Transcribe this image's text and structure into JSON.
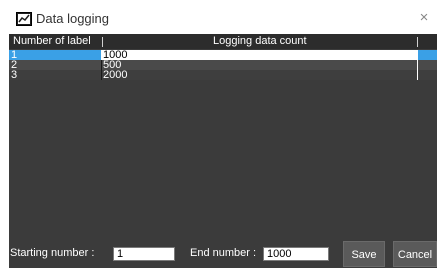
{
  "window": {
    "title": "Data logging",
    "close_glyph": "×",
    "icon": "data-logging-app-icon"
  },
  "table": {
    "headers": [
      "Number of label",
      "Logging data count"
    ],
    "rows": [
      {
        "label": "1",
        "count": "1000",
        "selected": true
      },
      {
        "label": "2",
        "count": "500",
        "selected": false
      },
      {
        "label": "3",
        "count": "2000",
        "selected": false
      }
    ]
  },
  "footer": {
    "start_label": "Starting number :",
    "start_value": "1",
    "end_label": "End number :",
    "end_value": "1000",
    "save_label": "Save",
    "cancel_label": "Cancel"
  },
  "colors": {
    "selection": "#3aa0e6",
    "body_bg": "#3b3b3b"
  }
}
